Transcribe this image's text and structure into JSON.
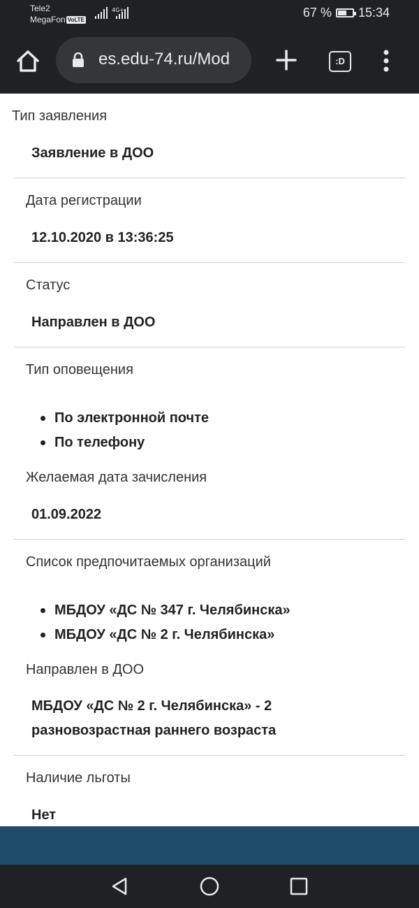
{
  "status_bar": {
    "carrier_1": "Tele2",
    "carrier_2": "MegaFon",
    "volte": "VoLTE",
    "network": "4G+",
    "battery": "67 %",
    "battery_level": 0.67,
    "time": "15:34"
  },
  "browser": {
    "url": "es.edu-74.ru/Mod",
    "tabs_label": ":D",
    "icons": [
      "home-icon",
      "lock-icon",
      "plus-icon",
      "tabs-icon",
      "more-vert-icon"
    ]
  },
  "details": {
    "application_type": {
      "label": "Тип заявления",
      "value": "Заявление в ДОО"
    },
    "registration_date": {
      "label": "Дата регистрации",
      "value": "12.10.2020 в 13:36:25"
    },
    "status": {
      "label": "Статус",
      "value": "Направлен в ДОО"
    },
    "notification_type": {
      "label": "Тип оповещения",
      "items": [
        "По электронной почте",
        "По телефону"
      ]
    },
    "enrollment_date": {
      "label": "Желаемая дата зачисления",
      "value": "01.09.2022"
    },
    "preferred_orgs": {
      "label": "Список предпочитаемых организаций",
      "items": [
        "МБДОУ «ДС № 347 г. Челябинска»",
        "МБДОУ «ДС № 2 г. Челябинска»"
      ]
    },
    "assigned": {
      "label": "Направлен в ДОО",
      "value_line1": "МБДОУ «ДС № 2 г. Челябинска» - 2",
      "value_line2": "разновозрастная раннего возраста"
    },
    "benefits": {
      "label": "Наличие льготы",
      "value": "Нет"
    }
  },
  "colors": {
    "toolbar": "#202124",
    "footer_band": "#1f4c6b"
  }
}
